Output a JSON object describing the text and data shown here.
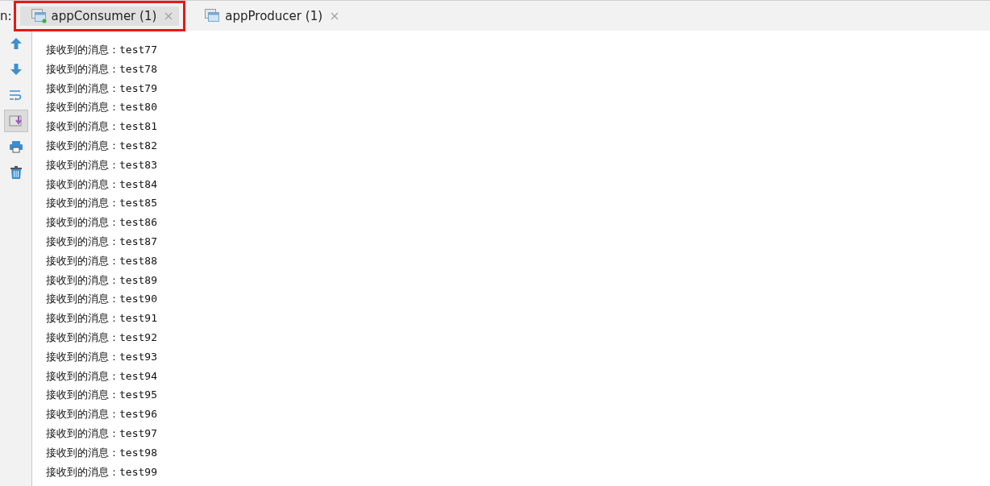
{
  "run_label": "n:",
  "tabs": [
    {
      "label": "appConsumer (1)",
      "selected": true,
      "running": true,
      "highlighted": true
    },
    {
      "label": "appProducer (1)",
      "selected": false,
      "running": false,
      "highlighted": false
    }
  ],
  "toolbar": [
    {
      "kind": "up",
      "selected": false
    },
    {
      "kind": "down",
      "selected": false
    },
    {
      "kind": "wrap",
      "selected": false
    },
    {
      "kind": "scroll-end",
      "selected": true
    },
    {
      "kind": "print",
      "selected": false
    },
    {
      "kind": "clear",
      "selected": false
    }
  ],
  "console_lines": [
    "接收到的消息：test77",
    "接收到的消息：test78",
    "接收到的消息：test79",
    "接收到的消息：test80",
    "接收到的消息：test81",
    "接收到的消息：test82",
    "接收到的消息：test83",
    "接收到的消息：test84",
    "接收到的消息：test85",
    "接收到的消息：test86",
    "接收到的消息：test87",
    "接收到的消息：test88",
    "接收到的消息：test89",
    "接收到的消息：test90",
    "接收到的消息：test91",
    "接收到的消息：test92",
    "接收到的消息：test93",
    "接收到的消息：test94",
    "接收到的消息：test95",
    "接收到的消息：test96",
    "接收到的消息：test97",
    "接收到的消息：test98",
    "接收到的消息：test99"
  ]
}
